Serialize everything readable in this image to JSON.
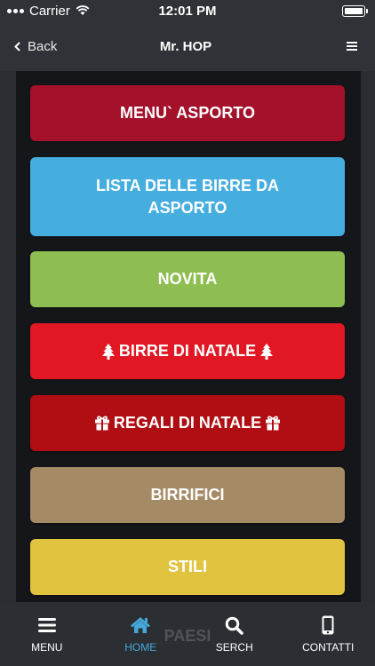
{
  "status": {
    "carrier": "Carrier",
    "time": "12:01 PM"
  },
  "nav": {
    "back_label": "Back",
    "title": "Mr. HOP"
  },
  "buttons": [
    {
      "label": "MENU` ASPORTO",
      "color": "#a3112b"
    },
    {
      "label": "LISTA DELLE BIRRE DA ASPORTO",
      "color": "#45aedf"
    },
    {
      "label": "NOVITA",
      "color": "#8ebd52"
    },
    {
      "label": "BIRRE DI NATALE",
      "color": "#e11823",
      "icon": "tree-icon"
    },
    {
      "label": "REGALI DI NATALE",
      "color": "#b00e12",
      "icon": "gift-icon"
    },
    {
      "label": "BIRRIFICI",
      "color": "#a58b65"
    },
    {
      "label": "STILI",
      "color": "#e1c33f"
    }
  ],
  "peek_text": "PAESI",
  "tabs": [
    {
      "label": "MENU",
      "icon": "menu-icon",
      "active": false
    },
    {
      "label": "HOME",
      "icon": "home-icon",
      "active": true
    },
    {
      "label": "SERCH",
      "icon": "search-icon",
      "active": false
    },
    {
      "label": "CONTATTI",
      "icon": "phone-icon",
      "active": false
    }
  ],
  "colors": {
    "accent": "#46a8d8",
    "background": "#2a2d31",
    "content": "#151619"
  }
}
